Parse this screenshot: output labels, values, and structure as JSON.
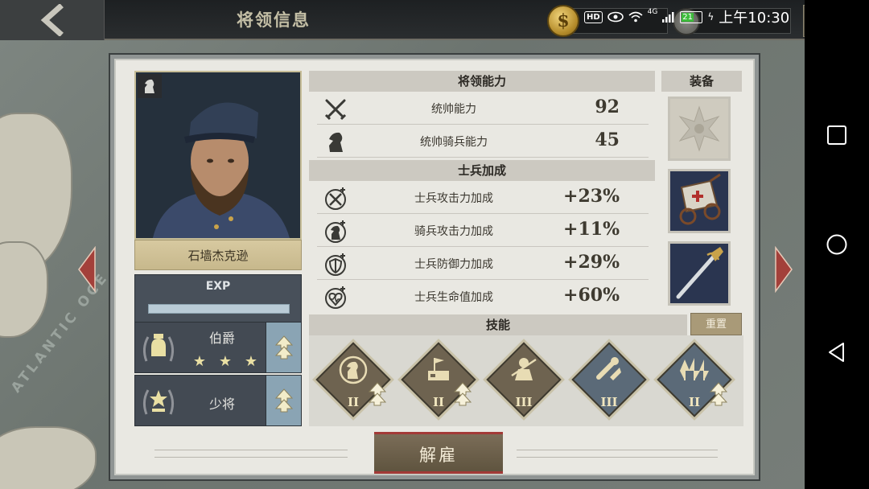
{
  "top_bar": {
    "title": "将领信息",
    "status": {
      "clock": "上午10:30",
      "battery": "21",
      "network": "4G",
      "hd": "HD"
    }
  },
  "general": {
    "name": "石墙杰克逊",
    "exp_label": "EXP",
    "ranks": [
      {
        "name": "伯爵",
        "stars": 3
      },
      {
        "name": "少将"
      }
    ]
  },
  "abilities": {
    "header": "将领能力",
    "items": [
      {
        "label": "统帅能力",
        "value": "92",
        "icon": "crossed-swords-icon"
      },
      {
        "label": "统帅骑兵能力",
        "value": "45",
        "icon": "horse-head-icon"
      }
    ]
  },
  "bonuses": {
    "header": "士兵加成",
    "items": [
      {
        "label": "士兵攻击力加成",
        "value": "+23%",
        "icon": "attack-bonus-icon"
      },
      {
        "label": "骑兵攻击力加成",
        "value": "+11%",
        "icon": "cavalry-bonus-icon"
      },
      {
        "label": "士兵防御力加成",
        "value": "+29%",
        "icon": "shield-bonus-icon"
      },
      {
        "label": "士兵生命值加成",
        "value": "+60%",
        "icon": "heart-bonus-icon"
      }
    ]
  },
  "equipment": {
    "header": "装备",
    "items": [
      "maltese-cross-icon",
      "ambulance-wagon-icon",
      "saber-icon"
    ]
  },
  "skills": {
    "header": "技能",
    "reset_label": "重置",
    "items": [
      {
        "tier": "II",
        "icon": "horse-medal-icon",
        "color": "#6e6350"
      },
      {
        "tier": "II",
        "icon": "fortification-flag-icon",
        "color": "#6e6350"
      },
      {
        "tier": "III",
        "icon": "soldier-charge-icon",
        "color": "#6e6350"
      },
      {
        "tier": "III",
        "icon": "cannon-ammo-icon",
        "color": "#5b6a78"
      },
      {
        "tier": "II",
        "icon": "forest-icon",
        "color": "#5b6a78"
      }
    ]
  },
  "dismiss_label": "解雇",
  "map": {
    "ocean_label": "ATLANTIC OCE"
  },
  "colors": {
    "accent": "#a33a37",
    "panel": "#e9e8e2",
    "rank_bg": "#434a53"
  }
}
